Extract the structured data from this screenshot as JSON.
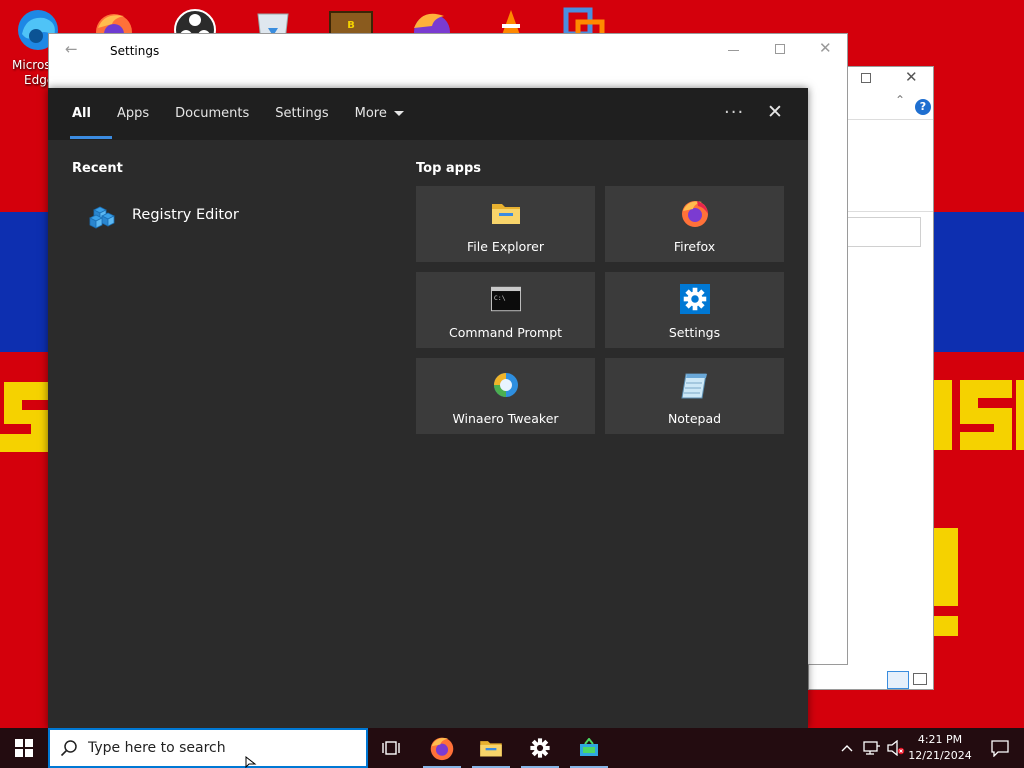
{
  "desktop": {
    "icon_label_line1": "Micros",
    "icon_label_line2": "Edge"
  },
  "settings_window": {
    "title": "Settings"
  },
  "search": {
    "tabs": [
      {
        "label": "All"
      },
      {
        "label": "Apps"
      },
      {
        "label": "Documents"
      },
      {
        "label": "Settings"
      },
      {
        "label": "More"
      }
    ],
    "recent_title": "Recent",
    "recent_items": [
      {
        "label": "Registry Editor",
        "icon": "registry-editor-icon"
      }
    ],
    "top_apps_title": "Top apps",
    "top_apps": [
      {
        "label": "File Explorer",
        "icon": "file-explorer-icon"
      },
      {
        "label": "Firefox",
        "icon": "firefox-icon"
      },
      {
        "label": "Command Prompt",
        "icon": "command-prompt-icon"
      },
      {
        "label": "Settings",
        "icon": "settings-gear-icon"
      },
      {
        "label": "Winaero Tweaker",
        "icon": "winaero-tweaker-icon"
      },
      {
        "label": "Notepad",
        "icon": "notepad-icon"
      }
    ],
    "more_options_glyph": "···",
    "close_glyph": "✕"
  },
  "taskbar": {
    "search_placeholder": "Type here to search",
    "time": "4:21 PM",
    "date": "12/21/2024"
  },
  "colors": {
    "accent": "#0078d4",
    "panel_bg": "#2b2b2b",
    "tile_bg": "#3b3b3b",
    "taskbar_bg": "#230c10"
  }
}
